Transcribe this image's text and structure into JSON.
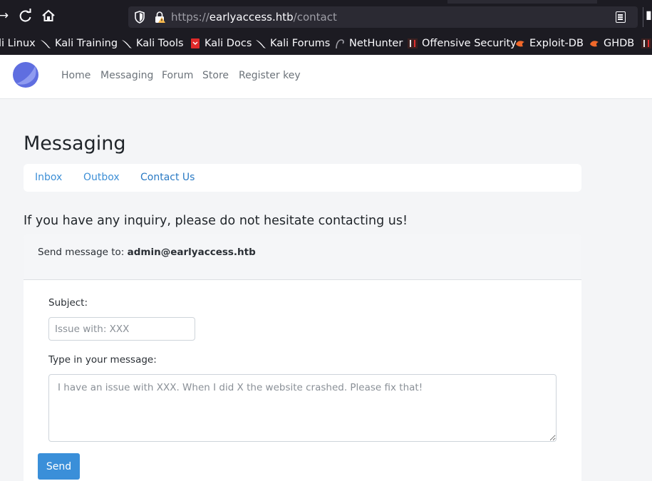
{
  "browser": {
    "url_scheme": "https://",
    "url_host": "earlyaccess.htb",
    "url_path": "/contact",
    "bookmarks": [
      {
        "label": "li Linux",
        "icon": "kali-dragon-icon"
      },
      {
        "label": "Kali Training",
        "icon": "kali-dragon-icon"
      },
      {
        "label": "Kali Tools",
        "icon": "kali-dragon-icon"
      },
      {
        "label": "Kali Docs",
        "icon": "kali-docs-icon"
      },
      {
        "label": "Kali Forums",
        "icon": "kali-dragon-icon"
      },
      {
        "label": "NetHunter",
        "icon": "nethunter-icon"
      },
      {
        "label": "Offensive Security",
        "icon": "offsec-icon"
      },
      {
        "label": "Exploit-DB",
        "icon": "exploitdb-icon"
      },
      {
        "label": "GHDB",
        "icon": "exploitdb-icon"
      }
    ]
  },
  "navbar": {
    "links": [
      "Home",
      "Messaging",
      "Forum",
      "Store",
      "Register key"
    ]
  },
  "page": {
    "title": "Messaging",
    "tabs": [
      "Inbox",
      "Outbox",
      "Contact Us"
    ],
    "lead": "If you have any inquiry, please do not hesitate contacting us!"
  },
  "form": {
    "header_prefix": "Send message to: ",
    "recipient": "admin@earlyaccess.htb",
    "subject_label": "Subject:",
    "subject_placeholder": "Issue with: XXX",
    "subject_value": "",
    "message_label": "Type in your message:",
    "message_placeholder": "I have an issue with XXX. When I did X the website crashed. Please fix that!",
    "message_value": "",
    "send_label": "Send"
  },
  "colors": {
    "accent": "#3a8fd9",
    "link": "#3d8fd6",
    "logo": "#5f6ee0"
  }
}
